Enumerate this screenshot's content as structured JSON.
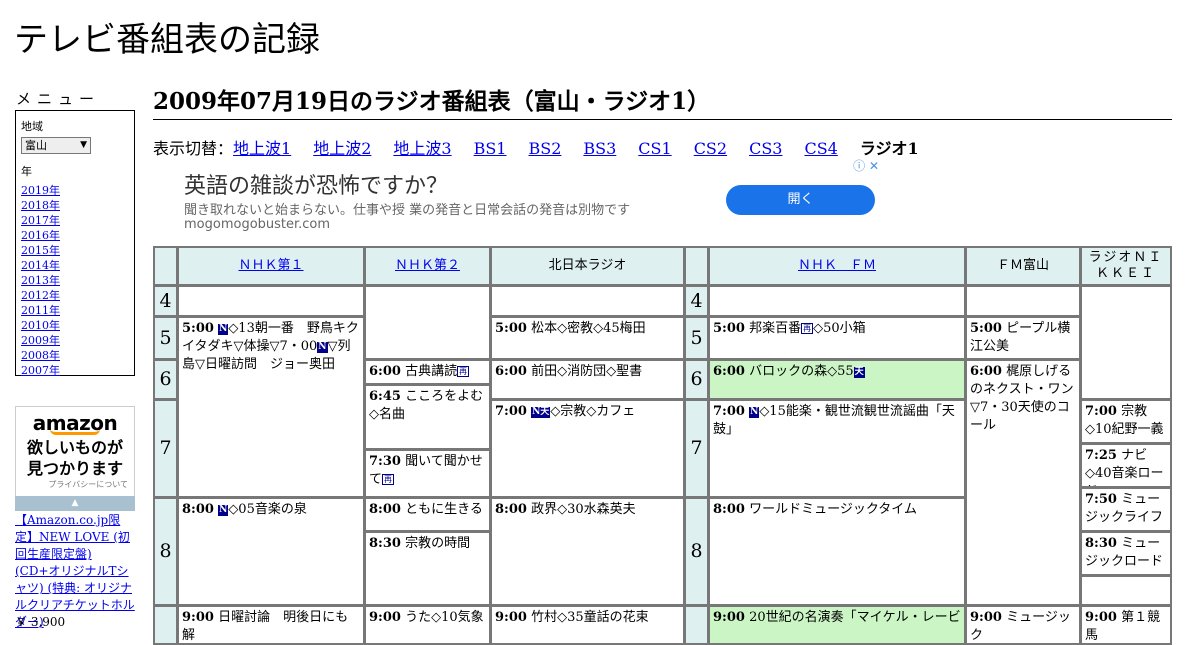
{
  "site": {
    "title": "テレビ番組表の記録"
  },
  "menu": {
    "label": "メニュー",
    "region_label": "地域",
    "region_value": "富山",
    "year_label": "年",
    "years": [
      "2019年",
      "2018年",
      "2017年",
      "2016年",
      "2015年",
      "2014年",
      "2013年",
      "2012年",
      "2011年",
      "2010年",
      "2009年",
      "2008年",
      "2007年"
    ]
  },
  "amazon_ad": {
    "logo": "amazon",
    "text1": "欲しいものが",
    "text2": "見つかります",
    "privacy": "プライバシーについて",
    "product": "【Amazon.co.jp限定】NEW LOVE (初回生産限定盤) (CD+オリジナルTシャツ) (特典: オリジナルクリアチケットホルダー)",
    "price": "￥ 3,900"
  },
  "heading": "2009年07月19日のラジオ番組表（富山・ラジオ1）",
  "switcher": {
    "label": "表示切替：",
    "links": [
      "地上波1",
      "地上波2",
      "地上波3",
      "BS1",
      "BS2",
      "BS3",
      "CS1",
      "CS2",
      "CS3",
      "CS4"
    ],
    "current": "ラジオ1"
  },
  "ad": {
    "headline": "英語の雑談が恐怖ですか？",
    "body": "聞き取れないと始まらない。仕事や授 業の発音と日常会話の発音は別物です",
    "domain": "mogomogobuster.com",
    "button": "開く",
    "close": "ⓘ ✕"
  },
  "channels": [
    "ＮＨＫ第１",
    "ＮＨＫ第２",
    "北日本ラジオ",
    "ＮＨＫ　ＦＭ",
    "ＦＭ富山",
    "ラジオＮＩＫＫＥＩ"
  ],
  "hours": [
    "4",
    "5",
    "6",
    "7",
    "8"
  ],
  "programs": {
    "nhk1_500_time": "5:00",
    "nhk1_500_badge": "N",
    "nhk1_500_text": "◇13朝一番　野鳥キクイタダキ▽体操▽7・00",
    "nhk1_500_badge2": "N",
    "nhk1_500_text2": "▽列島▽日曜訪問　ジョー奥田",
    "nhk1_800_time": "8:00",
    "nhk1_800_badge": "N",
    "nhk1_800_text": "◇05音楽の泉",
    "nhk1_900_time": "9:00",
    "nhk1_900_text": "日曜討論　明後日にも解",
    "nhk2_600_time": "6:00",
    "nhk2_600_text": "古典講読",
    "nhk2_645_time": "6:45",
    "nhk2_645_text": "こころをよむ◇名曲",
    "nhk2_730_time": "7:30",
    "nhk2_730_text": "聞いて聞かせて",
    "nhk2_800_time": "8:00",
    "nhk2_800_text": "ともに生きる",
    "nhk2_830_time": "8:30",
    "nhk2_830_text": "宗教の時間",
    "nhk2_900_time": "9:00",
    "nhk2_900_text": "うた◇10気象",
    "kn_500_time": "5:00",
    "kn_500_text": "松本◇密教◇45梅田",
    "kn_600_time": "6:00",
    "kn_600_text": "前田◇消防団◇聖書",
    "kn_700_time": "7:00",
    "kn_700_badge": "N天",
    "kn_700_text": "◇宗教◇カフェ",
    "kn_800_time": "8:00",
    "kn_800_text": "政界◇30水森英夫",
    "kn_900_time": "9:00",
    "kn_900_text": "竹村◇35童話の花束",
    "fm_500_time": "5:00",
    "fm_500_text": "邦楽百番",
    "fm_500_text2": "◇50小箱",
    "fm_600_time": "6:00",
    "fm_600_text": "バロックの森◇55",
    "fm_700_time": "7:00",
    "fm_700_badge": "N",
    "fm_700_text": "◇15能楽・観世流観世流謡曲「天鼓」",
    "fm_800_time": "8:00",
    "fm_800_text": "ワールドミュージックタイム",
    "fm_900_time": "9:00",
    "fm_900_text": "20世紀の名演奏「マイケル・レービ",
    "fmt_500_time": "5:00",
    "fmt_500_text": "ピープル横江公美",
    "fmt_600_time": "6:00",
    "fmt_600_text": "梶原しげるのネクスト・ワン▽7・30天使のコール",
    "fmt_900_time": "9:00",
    "fmt_900_text": "ミュージック",
    "nk_700_time": "7:00",
    "nk_700_text": "宗教◇10紀野一義",
    "nk_725_time": "7:25",
    "nk_725_text": "ナビ◇40音楽ロード",
    "nk_750_time": "7:50",
    "nk_750_text": "ミュージックライフ",
    "nk_830_time": "8:30",
    "nk_830_text": "ミュージックロード",
    "nk_900_time": "9:00",
    "nk_900_text": "第１競馬",
    "badge_re": "再",
    "badge_ten": "天"
  }
}
